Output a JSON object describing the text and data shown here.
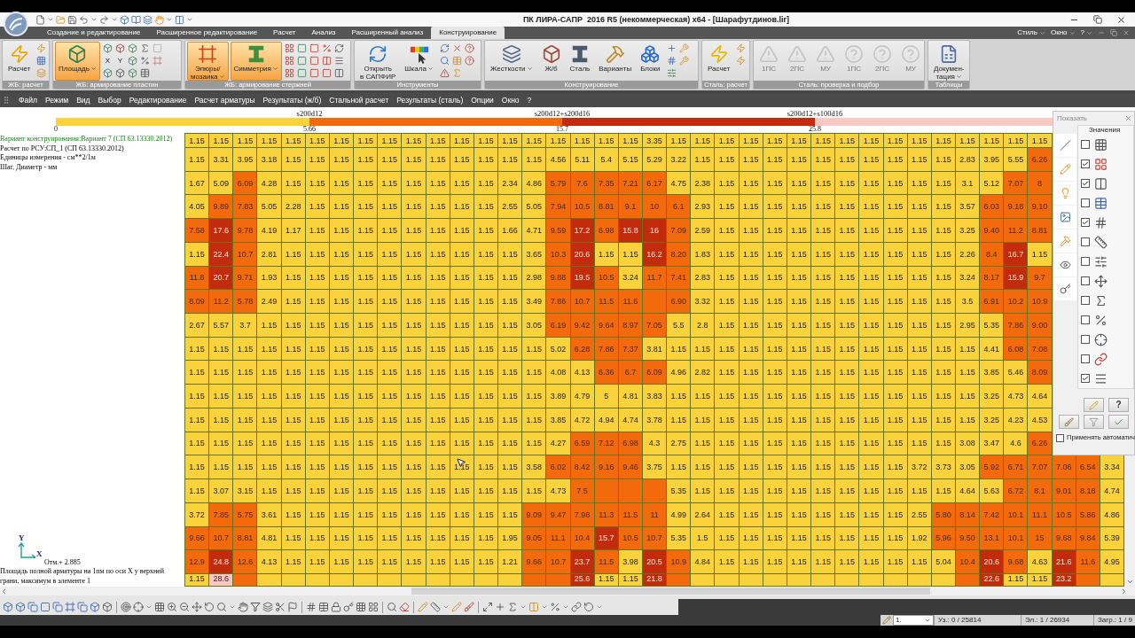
{
  "window": {
    "title": "ПК ЛИРА-САПР  2016 R5 (некоммерческая) x64 - [Шарафутдинов.lir]"
  },
  "tabs": [
    {
      "label": "Создание и редактирование",
      "selected": false
    },
    {
      "label": "Расширенное редактирование",
      "selected": false
    },
    {
      "label": "Расчет",
      "selected": false
    },
    {
      "label": "Анализ",
      "selected": false
    },
    {
      "label": "Расширенный анализ",
      "selected": false
    },
    {
      "label": "Конструирование",
      "selected": true
    }
  ],
  "tab_bar_menus": [
    "Стиль",
    "Окно",
    "?"
  ],
  "ribbon": {
    "groups": [
      {
        "label": "ЖБ: расчет",
        "buttons": [
          {
            "label": "Расчет",
            "selected": false,
            "dropdown": false
          }
        ]
      },
      {
        "label": "ЖБ: армирование пластин",
        "buttons": [
          {
            "label": "Площадь",
            "selected": true,
            "dropdown": true
          }
        ],
        "tools": [
          {
            "label": "X"
          },
          {
            "label": "Y"
          }
        ]
      },
      {
        "label": "ЖБ: армирование стержней",
        "buttons": [
          {
            "label": "Эпюры/\nмозаика",
            "selected": true,
            "dropdown": true
          },
          {
            "label": "Симметрия",
            "selected": true,
            "dropdown": true
          }
        ]
      },
      {
        "label": "Инструменты",
        "buttons": [
          {
            "label": "Открыть\nв САПФИР",
            "selected": false,
            "dropdown": false
          },
          {
            "label": "Шкала",
            "selected": false,
            "dropdown": true
          }
        ]
      },
      {
        "label": "Конструирование",
        "buttons": [
          {
            "label": "Жесткости",
            "selected": false,
            "dropdown": true
          },
          {
            "label": "Ж/б",
            "selected": false,
            "dropdown": false
          },
          {
            "label": "Сталь",
            "selected": false,
            "dropdown": false
          },
          {
            "label": "Варианты",
            "selected": false,
            "dropdown": false
          },
          {
            "label": "Блоки",
            "selected": false,
            "dropdown": false
          }
        ]
      },
      {
        "label": "Сталь: расчет",
        "buttons": [
          {
            "label": "Расчет",
            "selected": false,
            "dropdown": false
          }
        ]
      },
      {
        "label": "Сталь: проверка и подбор",
        "buttons": [
          {
            "label": "1ПС",
            "disabled": true
          },
          {
            "label": "2ПС",
            "disabled": true
          },
          {
            "label": "МУ",
            "disabled": true
          },
          {
            "label": "1ПС",
            "disabled": true
          },
          {
            "label": "2ПС",
            "disabled": true
          },
          {
            "label": "МУ",
            "disabled": true
          }
        ]
      },
      {
        "label": "Таблицы",
        "buttons": [
          {
            "label": "Докумен-\nтация",
            "selected": false,
            "dropdown": true
          }
        ]
      }
    ]
  },
  "menu": [
    "Файл",
    "Режим",
    "Вид",
    "Выбор",
    "Редактирование",
    "Расчет арматуры",
    "Результаты (ж/б)",
    "Стальной расчет",
    "Результаты (сталь)",
    "Опции",
    "Окно",
    "?"
  ],
  "legend": {
    "start": "0",
    "segments": [
      {
        "label": "s200d12",
        "end": "5.66",
        "color": "#fad33c"
      },
      {
        "label": "s200d12+s200d16",
        "end": "15.7",
        "color": "#f26a0c"
      },
      {
        "label": "s200d12+s100d16",
        "end": "25.8",
        "color": "#c22b0b"
      },
      {
        "color": "#fac8c2"
      }
    ]
  },
  "info": {
    "variant": "Вариант конструирования:Вариант 7 (СП 63.13330.2012)",
    "lines": [
      "Расчет по РСУ:СП_1 (СП 63.13330.2012)",
      "Единицы измерения - см**2/1м",
      "Шаг, Диаметр - мм"
    ]
  },
  "mesh": {
    "rows": [
      [
        "1.15",
        "1.15",
        "1.15",
        "1.15",
        "1.15",
        "1.15",
        "1.15",
        "1.15",
        "1.15",
        "1.15",
        "1.15",
        "1.15",
        "1.15",
        "1.15",
        "1.15",
        "1.15",
        "1.15",
        "1.15",
        "1.15",
        "3.35",
        "1.15",
        "1.15",
        "1.15",
        "1.15",
        "1.15",
        "1.15",
        "1.15",
        "1.15",
        "1.15",
        "1.15",
        "1.15",
        "1.15",
        "1.15",
        "1.15",
        "1.15",
        "1.15"
      ],
      [
        "1.15",
        "3.31",
        "3.95",
        "3.18",
        "1.15",
        "1.15",
        "1.15",
        "1.15",
        "1.15",
        "1.15",
        "1.15",
        "1.15",
        "1.15",
        "1.15",
        "1.15",
        "4.56",
        "5.11",
        "5.4",
        "5.15",
        "5.29",
        "3.22",
        "1.15",
        "1.15",
        "1.15",
        "1.15",
        "1.15",
        "1.15",
        "1.15",
        "1.15",
        "1.15",
        "1.15",
        "1.15",
        "2.83",
        "3.95",
        "5.55",
        "6.26"
      ],
      [
        "1.67",
        "5.09",
        "6.09",
        "4.28",
        "1.15",
        "1.15",
        "1.15",
        "1.15",
        "1.15",
        "1.15",
        "1.15",
        "1.15",
        "1.15",
        "2.34",
        "4.86",
        "5.79",
        "7.6",
        "7.35",
        "7.21",
        "6.17",
        "4.75",
        "2.38",
        "1.15",
        "1.15",
        "1.15",
        "1.15",
        "1.15",
        "1.15",
        "1.15",
        "1.15",
        "1.15",
        "1.15",
        "3.1",
        "5.12",
        "7.07",
        "8"
      ],
      [
        "4.05",
        "9.89",
        "7.83",
        "5.05",
        "2.28",
        "1.15",
        "1.15",
        "1.15",
        "1.15",
        "1.15",
        "1.15",
        "1.15",
        "1.15",
        "2.55",
        "5.05",
        "7.94",
        "10.5",
        "8.81",
        "9.1",
        "10",
        "6.1",
        "2.93",
        "1.15",
        "1.15",
        "1.15",
        "1.15",
        "1.15",
        "1.15",
        "1.15",
        "1.15",
        "1.15",
        "1.15",
        "3.57",
        "6.03",
        "9.18",
        "9.10"
      ],
      [
        "7.58",
        "17.6",
        "9.78",
        "4.19",
        "1.17",
        "1.15",
        "1.15",
        "1.15",
        "1.15",
        "1.15",
        "1.15",
        "1.15",
        "1.15",
        "1.66",
        "4.71",
        "9.59",
        "17.2",
        "6.98",
        "15.8",
        "16",
        "7.09",
        "2.59",
        "1.15",
        "1.15",
        "1.15",
        "1.15",
        "1.15",
        "1.15",
        "1.15",
        "1.15",
        "1.15",
        "1.15",
        "3.25",
        "9.40",
        "11.2",
        "8.81"
      ],
      [
        "1.15",
        "22.4",
        "10.7",
        "2.81",
        "1.15",
        "1.15",
        "1.15",
        "1.15",
        "1.15",
        "1.15",
        "1.15",
        "1.15",
        "1.15",
        "1.15",
        "3.65",
        "10.3",
        "20.6",
        "1.15",
        "1.15",
        "16.2",
        "8.20",
        "1.83",
        "1.15",
        "1.15",
        "1.15",
        "1.15",
        "1.15",
        "1.15",
        "1.15",
        "1.15",
        "1.15",
        "1.15",
        "2.26",
        "8.4",
        "16.7",
        "1.15"
      ],
      [
        "11.8",
        "20.7",
        "9.71",
        "1.93",
        "1.15",
        "1.15",
        "1.15",
        "1.15",
        "1.15",
        "1.15",
        "1.15",
        "1.15",
        "1.15",
        "1.15",
        "2.98",
        "9.88",
        "19.5",
        "10.5",
        "3.24",
        "11.7",
        "7.41",
        "2.83",
        "1.15",
        "1.15",
        "1.15",
        "1.15",
        "1.15",
        "1.15",
        "1.15",
        "1.15",
        "1.15",
        "1.15",
        "3.24",
        "8.17",
        "15.9",
        "9.7"
      ],
      [
        "8.09",
        "11.2",
        "5.78",
        "2.49",
        "1.15",
        "1.15",
        "1.15",
        "1.15",
        "1.15",
        "1.15",
        "1.15",
        "1.15",
        "1.15",
        "1.15",
        "3.49",
        "7.86",
        "10.7",
        "11.5",
        "11.6",
        {
          "color": "#f26a0c"
        },
        "6.90",
        "3.32",
        "1.15",
        "1.15",
        "1.15",
        "1.15",
        "1.15",
        "1.15",
        "1.15",
        "1.15",
        "1.15",
        "1.15",
        "3.5",
        "6.91",
        "10.2",
        "10.9"
      ],
      [
        "2.67",
        "5.57",
        "3.7",
        "1.15",
        "1.15",
        "1.15",
        "1.15",
        "1.15",
        "1.15",
        "1.15",
        "1.15",
        "1.15",
        "1.15",
        "1.15",
        "3.05",
        "6.19",
        "9.42",
        "9.64",
        "8.97",
        "7.05",
        "5.5",
        "2.8",
        "1.15",
        "1.15",
        "1.15",
        "1.15",
        "1.15",
        "1.15",
        "1.15",
        "1.15",
        "1.15",
        "1.15",
        "2.95",
        "5.35",
        "7.86",
        "9.00"
      ],
      [
        "1.15",
        "1.15",
        "1.15",
        "1.15",
        "1.15",
        "1.15",
        "1.15",
        "1.15",
        "1.15",
        "1.15",
        "1.15",
        "1.15",
        "1.15",
        "1.15",
        "1.15",
        "5.02",
        "6.28",
        "7.86",
        "7.37",
        "3.81",
        "1.15",
        "1.15",
        "1.15",
        "1.15",
        "1.15",
        "1.15",
        "1.15",
        "1.15",
        "1.15",
        "1.15",
        "1.15",
        "1.15",
        "1.15",
        "4.41",
        "6.08",
        "7.08"
      ],
      [
        "1.15",
        "1.15",
        "1.15",
        "1.15",
        "1.15",
        "1.15",
        "1.15",
        "1.15",
        "1.15",
        "1.15",
        "1.15",
        "1.15",
        "1.15",
        "1.15",
        "1.15",
        "4.08",
        "4.13",
        "6.36",
        "6.7",
        "6.09",
        "4.96",
        "2.82",
        "1.15",
        "1.15",
        "1.15",
        "1.15",
        "1.15",
        "1.15",
        "1.15",
        "1.15",
        "1.15",
        "1.15",
        "1.15",
        "3.85",
        "5.46",
        "8.09"
      ],
      [
        "1.15",
        "1.15",
        "1.15",
        "1.15",
        "1.15",
        "1.15",
        "1.15",
        "1.15",
        "1.15",
        "1.15",
        "1.15",
        "1.15",
        "1.15",
        "1.15",
        "1.15",
        "3.89",
        "4.79",
        "5",
        "4.81",
        "3.83",
        "1.15",
        "1.15",
        "1.15",
        "1.15",
        "1.15",
        "1.15",
        "1.15",
        "1.15",
        "1.15",
        "1.15",
        "1.15",
        "1.15",
        "1.15",
        "3.25",
        "4.73",
        "4.64"
      ],
      [
        "1.15",
        "1.15",
        "1.15",
        "1.15",
        "1.15",
        "1.15",
        "1.15",
        "1.15",
        "1.15",
        "1.15",
        "1.15",
        "1.15",
        "1.15",
        "1.15",
        "1.15",
        "3.85",
        "4.72",
        "4.94",
        "4.74",
        "3.78",
        "1.15",
        "1.15",
        "1.15",
        "1.15",
        "1.15",
        "1.15",
        "1.15",
        "1.15",
        "1.15",
        "1.15",
        "1.15",
        "1.15",
        "1.15",
        "3.25",
        "4.23",
        "4.53"
      ],
      [
        "1.15",
        "1.15",
        "1.15",
        "1.15",
        "1.15",
        "1.15",
        "1.15",
        "1.15",
        "1.15",
        "1.15",
        "1.15",
        "1.15",
        "1.15",
        "1.15",
        "1.15",
        "4.27",
        "6.59",
        "7.12",
        "6.98",
        "4.3",
        "2.75",
        "1.15",
        "1.15",
        "1.15",
        "1.15",
        "1.15",
        "1.15",
        "1.15",
        "1.15",
        "1.15",
        "1.15",
        "1.15",
        "3.08",
        "3.47",
        "4.6",
        "6.26"
      ],
      [
        "1.15",
        "1.15",
        "1.15",
        "1.15",
        "1.15",
        "1.15",
        "1.15",
        "1.15",
        "1.15",
        "1.15",
        "1.15",
        "1.15",
        "1.15",
        "1.15",
        "3.58",
        "6.02",
        "8.42",
        "9.16",
        "9.46",
        "3.75",
        "1.15",
        "1.15",
        "1.15",
        "1.15",
        "1.15",
        "1.15",
        "1.15",
        "1.15",
        "1.15",
        "1.15",
        "3.72",
        "3.73",
        "3.05",
        "5.92",
        "6.71",
        "7.07",
        "7.06",
        "6.54",
        "3.34"
      ],
      [
        "1.15",
        "3.07",
        "3.15",
        "1.15",
        "1.15",
        "1.15",
        "1.15",
        "1.15",
        "1.15",
        "1.15",
        "1.15",
        "1.15",
        "1.15",
        "1.15",
        "1.15",
        "4.73",
        "7.5",
        {
          "color": "#f26a0c"
        },
        {
          "color": "#f26a0c"
        },
        {
          "color": "#f26a0c"
        },
        "5.35",
        "1.15",
        "1.15",
        "1.15",
        "1.15",
        "1.15",
        "1.15",
        "1.15",
        "1.15",
        "1.15",
        "1.15",
        "1.15",
        "4.64",
        "5.63",
        "6.72",
        "8.1",
        "9.01",
        "8.18",
        "4.74"
      ],
      [
        "3.72",
        "7.85",
        "5.75",
        "3.61",
        "1.15",
        "1.15",
        "1.15",
        "1.15",
        "1.15",
        "1.15",
        "1.15",
        "1.15",
        "1.15",
        "1.15",
        "9.09",
        "9.47",
        "7.98",
        "11.3",
        "11.5",
        "11",
        "4.99",
        "2.64",
        "1.15",
        "1.15",
        "1.15",
        "1.15",
        "1.15",
        "1.15",
        "1.15",
        "1.15",
        "2.55",
        "5.80",
        "8.14",
        "7.42",
        "10.1",
        "11.1",
        "10.5",
        "5.86",
        "4.86"
      ],
      [
        "9.66",
        "10.7",
        "8.81",
        "4.81",
        "1.15",
        "1.15",
        "1.15",
        "1.15",
        "1.15",
        "1.15",
        "1.15",
        "1.15",
        "1.15",
        "1.95",
        "9.05",
        "11.1",
        "10.4",
        "15.7",
        "10.5",
        "10.7",
        "5.35",
        "1.5",
        "1.15",
        "1.15",
        "1.15",
        "1.15",
        "1.15",
        "1.15",
        "1.15",
        "1.15",
        "1.92",
        "5.96",
        "9.50",
        "13.1",
        "10.1",
        "15",
        "9.68",
        "9.84",
        "5.39"
      ],
      [
        "12.9",
        "24.8",
        "12.6",
        "4.13",
        "1.15",
        "1.15",
        "1.15",
        "1.15",
        "1.15",
        "1.15",
        "1.15",
        "1.15",
        "1.15",
        "1.21",
        "9.66",
        "10.7",
        "23.7",
        "11.5",
        "3.98",
        "20.5",
        "10.9",
        "4.84",
        "1.15",
        "1.15",
        "1.15",
        "1.15",
        "1.15",
        "1.15",
        "1.15",
        "1.15",
        "1.15",
        "5.04",
        "10.4",
        "20.6",
        "9.68",
        "4.63",
        "21.6",
        "11.6",
        "4.95"
      ],
      [
        "1.15",
        "28.6",
        {
          "color": "#f26a0c"
        },
        {
          "color": "#fad33c"
        },
        {
          "color": "#fad33c"
        },
        {
          "color": "#fad33c"
        },
        {
          "color": "#fad33c"
        },
        {
          "color": "#fad33c"
        },
        {
          "color": "#fad33c"
        },
        {
          "color": "#fad33c"
        },
        {
          "color": "#fad33c"
        },
        {
          "color": "#fad33c"
        },
        {
          "color": "#fad33c"
        },
        {
          "color": "#fad33c"
        },
        {
          "color": "#f26a0c"
        },
        {
          "color": "#f26a0c"
        },
        "25.6",
        "1.15",
        "1.15",
        "21.8",
        {
          "color": "#f26a0c"
        },
        {
          "color": "#fad33c"
        },
        {
          "color": "#fad33c"
        },
        {
          "color": "#fad33c"
        },
        {
          "color": "#fad33c"
        },
        {
          "color": "#fad33c"
        },
        {
          "color": "#fad33c"
        },
        {
          "color": "#fad33c"
        },
        {
          "color": "#fad33c"
        },
        {
          "color": "#fad33c"
        },
        {
          "color": "#fad33c"
        },
        {
          "color": "#fad33c"
        },
        {
          "color": "#f26a0c"
        },
        "22.6",
        "1.15",
        "1.15",
        "23.2",
        {
          "color": "#f26a0c"
        },
        {
          "color": "#fad33c"
        }
      ]
    ]
  },
  "axes": {
    "y": "Y",
    "x": "X"
  },
  "elevation": "Отм.+ 2.885",
  "caption": "Площадь полной арматуры на 1пм по оси X у верхней грани, максимум в элементе 1",
  "panel": {
    "title": "Показать",
    "header": "Значения",
    "options": [
      {
        "checked": false
      },
      {
        "checked": true
      },
      {
        "checked": true
      },
      {
        "checked": false
      },
      {
        "checked": true
      },
      {
        "checked": false
      },
      {
        "checked": false
      },
      {
        "checked": false
      },
      {
        "checked": false
      },
      {
        "checked": false
      },
      {
        "checked": false
      },
      {
        "checked": false
      },
      {
        "checked": true
      }
    ],
    "help": "?",
    "auto": {
      "label": "Применять автоматич",
      "checked": false
    }
  },
  "status_bar": {
    "layer": "1.",
    "nodes": "Уз.: 0 / 25814",
    "elements": "Эл.: 1 / 26934",
    "loads": "Загр.: 1 / 9"
  }
}
